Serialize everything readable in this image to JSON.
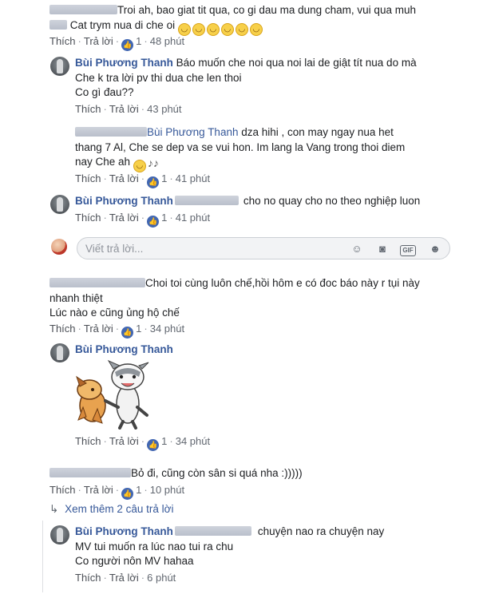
{
  "comments": [
    {
      "lines": [
        "Troi ah, bao giat tit qua, co gi dau ma dung cham, vui qua muh",
        "Cat trym nua di che oi"
      ],
      "actions": {
        "like": "Thích",
        "reply": "Trả lời",
        "count": "1",
        "time": "48 phút"
      }
    },
    {
      "author": "Bùi Phương Thanh",
      "lines": [
        "Báo muốn che noi qua noi lai de giật tít nua do mà",
        "Che k tra lời pv thi dua che len thoi",
        "Co gì đau??"
      ],
      "actions": {
        "like": "Thích",
        "reply": "Trả lời",
        "time": "43 phút"
      }
    },
    {
      "mention": "Bùi Phương Thanh",
      "lines": [
        "dza hihi , con may ngay nua het",
        "thang 7 Al, Che se dep va se vui hon. Im lang la Vang trong thoi diem",
        "nay Che ah"
      ],
      "actions": {
        "like": "Thích",
        "reply": "Trả lời",
        "count": "1",
        "time": "41 phút"
      }
    },
    {
      "author": "Bùi Phương Thanh",
      "lines": [
        "cho no quay cho no theo nghiệp luon"
      ],
      "actions": {
        "like": "Thích",
        "reply": "Trả lời",
        "count": "1",
        "time": "41 phút"
      }
    },
    {
      "lines": [
        "Choi toi cùng luôn chế,hồi hôm e có đoc báo này r tụi này",
        "nhanh thiệt",
        "Lúc nào e cũng ủng hộ chế"
      ],
      "actions": {
        "like": "Thích",
        "reply": "Trả lời",
        "count": "1",
        "time": "34 phút"
      }
    },
    {
      "author": "Bùi Phương Thanh",
      "actions": {
        "like": "Thích",
        "reply": "Trả lời",
        "count": "1",
        "time": "34 phút"
      }
    },
    {
      "lines": [
        "Bỏ đi, cũng còn sân si quá nha :)))))"
      ],
      "actions": {
        "like": "Thích",
        "reply": "Trả lời",
        "count": "1",
        "time": "10 phút"
      }
    },
    {
      "author": "Bùi Phương Thanh",
      "lines": [
        "chuyện nao ra chuyện nay",
        "MV tui muốn ra lúc nao tui ra chu",
        "Co người nôn MV hahaa"
      ],
      "actions": {
        "like": "Thích",
        "reply": "Trả lời",
        "time": "6 phút"
      }
    }
  ],
  "reply_box": {
    "placeholder": "Viết trả lời..."
  },
  "see_more": "Xem thêm 2 câu trả lời",
  "colors": {
    "link": "#365899",
    "like": "#4267b2",
    "muted": "#616770"
  }
}
